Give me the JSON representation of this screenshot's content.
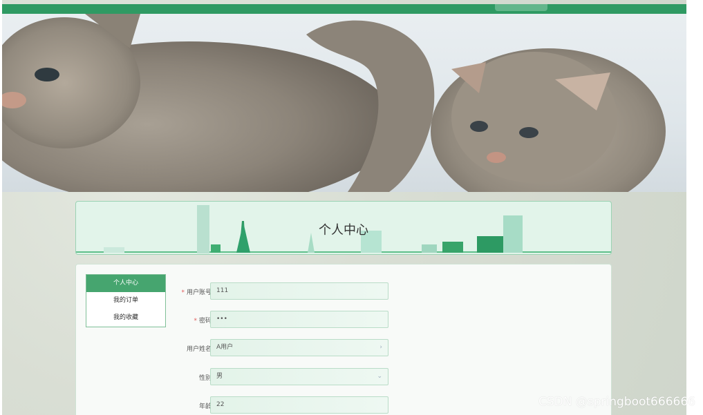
{
  "header": {
    "accent_color": "#2f9a63"
  },
  "banner": {
    "image_label": "kittens banner",
    "slides": 3,
    "active_slide": 3
  },
  "page_title": "个人中心",
  "sidebar": {
    "items": [
      {
        "label": "个人中心",
        "active": true
      },
      {
        "label": "我的订单",
        "active": false
      },
      {
        "label": "我的收藏",
        "active": false
      }
    ]
  },
  "form": {
    "account": {
      "label": "用户账号",
      "value": "111",
      "required": "*"
    },
    "password": {
      "label": "密码",
      "value": "•••",
      "required": "*"
    },
    "name": {
      "label": "用户姓名",
      "value": "A用户"
    },
    "gender": {
      "label": "性别",
      "value": "男"
    },
    "age": {
      "label": "年龄",
      "value": "22"
    }
  },
  "watermark": "CSDN @springboot666666"
}
